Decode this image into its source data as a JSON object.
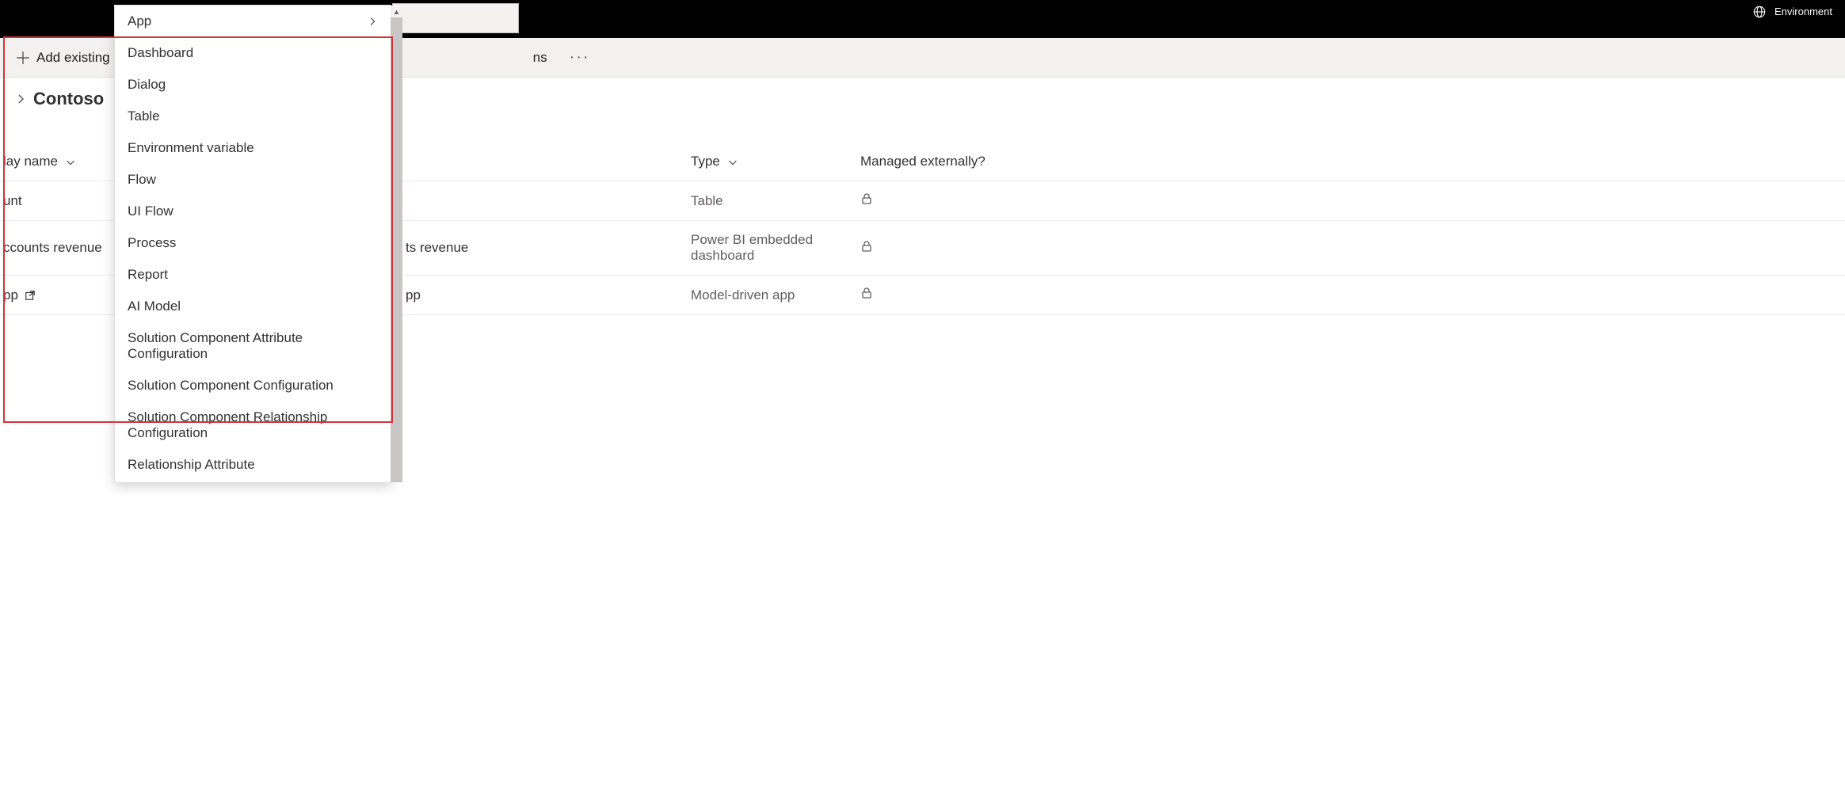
{
  "header": {
    "environment_label": "Environment"
  },
  "command_bar": {
    "add_existing_label": "Add existing",
    "solutions_label": "ns",
    "more_label": "···"
  },
  "title": {
    "solution_name": "Contoso"
  },
  "dropdown": {
    "items": [
      {
        "label": "App",
        "has_submenu": true
      },
      {
        "label": "Dashboard",
        "has_submenu": false
      },
      {
        "label": "Dialog",
        "has_submenu": false
      },
      {
        "label": "Table",
        "has_submenu": false
      },
      {
        "label": "Environment variable",
        "has_submenu": false
      },
      {
        "label": "Flow",
        "has_submenu": false
      },
      {
        "label": "UI Flow",
        "has_submenu": false
      },
      {
        "label": "Process",
        "has_submenu": false
      },
      {
        "label": "Report",
        "has_submenu": false
      },
      {
        "label": "AI Model",
        "has_submenu": false
      },
      {
        "label": "Solution Component Attribute Configuration",
        "has_submenu": false
      },
      {
        "label": "Solution Component Configuration",
        "has_submenu": false
      },
      {
        "label": "Solution Component Relationship Configuration",
        "has_submenu": false
      },
      {
        "label": "Relationship Attribute",
        "has_submenu": false
      }
    ]
  },
  "table": {
    "columns": {
      "display_name": "lay name",
      "name2": "",
      "type": "Type",
      "managed_externally": "Managed externally?"
    },
    "rows": [
      {
        "display_name": "unt",
        "name2": "",
        "type": "Table",
        "locked": true,
        "external": false
      },
      {
        "display_name": "ccounts revenue",
        "name2": "ts revenue",
        "type": "Power BI embedded dashboard",
        "locked": true,
        "external": false
      },
      {
        "display_name": "pp",
        "name2": "pp",
        "type": "Model-driven app",
        "locked": true,
        "external": true
      }
    ]
  }
}
